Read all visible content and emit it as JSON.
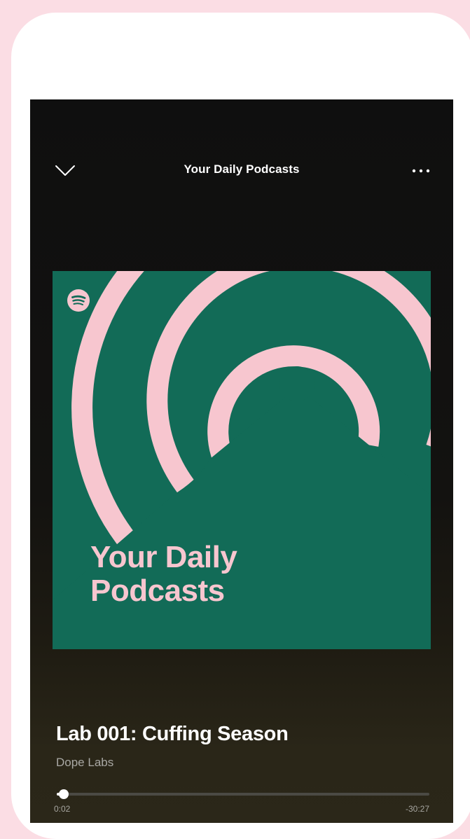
{
  "header": {
    "title": "Your Daily Podcasts",
    "collapse_icon": "chevron-down-icon",
    "more_icon": "more-horizontal-icon"
  },
  "artwork": {
    "title_line1": "Your Daily",
    "title_line2": "Podcasts",
    "logo_icon": "spotify-logo-icon",
    "background_color": "#126b57",
    "accent_color": "#f7c6cf"
  },
  "episode": {
    "title": "Lab 001: Cuffing Season",
    "show": "Dope Labs"
  },
  "playback": {
    "elapsed": "0:02",
    "remaining": "-30:27",
    "progress_fraction": 0.011
  },
  "colors": {
    "page_background": "#fbdde4",
    "phone_frame": "#ffffff",
    "screen_background": "#121212"
  }
}
